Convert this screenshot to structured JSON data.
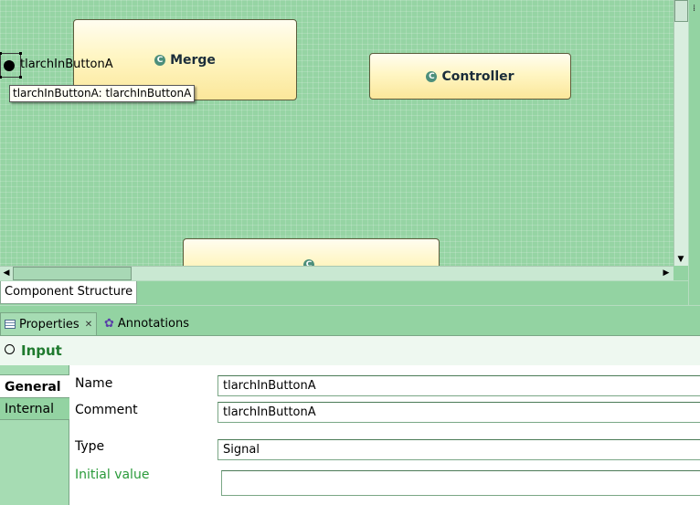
{
  "diagram": {
    "blocks": [
      {
        "id": "merge",
        "label": "Merge",
        "icon": "class-c-icon"
      },
      {
        "id": "controller",
        "label": "Controller",
        "icon": "class-c-icon"
      },
      {
        "id": "bottom",
        "label": "",
        "icon": "class-c-icon"
      }
    ],
    "port_label": "tlarchInButtonA",
    "tooltip": "tlarchInButtonA: tlarchInButtonA"
  },
  "editor_tab": {
    "label": "Component Structure"
  },
  "properties_view": {
    "tabs": [
      {
        "label": "Properties",
        "icon": "properties-list-icon",
        "active": true
      },
      {
        "label": "Annotations",
        "icon": "gear-icon",
        "active": false
      }
    ],
    "header_title": "Input",
    "side_tabs": [
      {
        "label": "General",
        "active": true
      },
      {
        "label": "Internal",
        "active": false
      }
    ],
    "fields": {
      "name_label": "Name",
      "name_value": "tlarchInButtonA",
      "comment_label": "Comment",
      "comment_value": "tlarchInButtonA",
      "type_label": "Type",
      "type_value": "Signal",
      "initial_label": "Initial value",
      "initial_value": ""
    }
  },
  "colors": {
    "background": "#93d3a2",
    "block_fill": "#fff6c4",
    "header_title": "#1f7a2e"
  }
}
